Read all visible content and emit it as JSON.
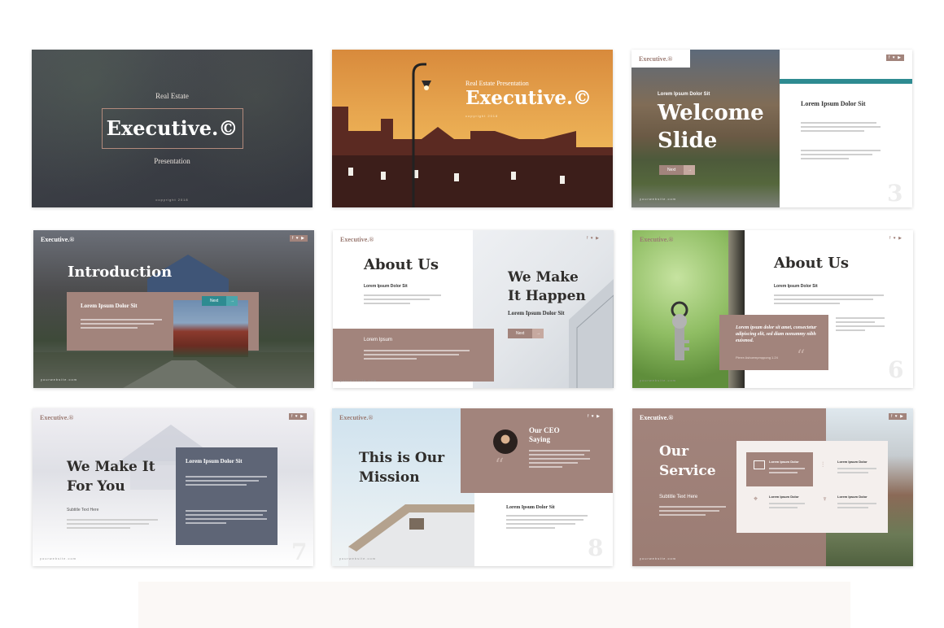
{
  "slides": [
    {
      "overline": "Real Estate",
      "title": "Executive.©",
      "subtitle": "Presentation",
      "footer": "copyright 2018"
    },
    {
      "overline": "Real Estate Presentation",
      "title": "Executive.©",
      "footer": "copyright 2018"
    },
    {
      "brand": "Executive.®",
      "social": "f ♥ ▶",
      "small_label": "Lorem Ipsum Dolor Sit",
      "title_line1": "Welcome",
      "title_line2": "Slide",
      "button": "Next",
      "panel_heading": "Lorem Ipsum Dolor Sit",
      "number": "3",
      "website": "yourwebsite.com"
    },
    {
      "brand": "Executive.®",
      "social": "f ♥ ▶",
      "title": "Introduction",
      "box_heading": "Lorem Ipsum Dolor Sit",
      "button": "Next",
      "website": "yourwebsite.com"
    },
    {
      "brand": "Executive.®",
      "social": "f ♥ ▶",
      "title": "About Us",
      "subheading": "Lorem Ipsum Dolor Sit",
      "box_heading": "Lorem Ipsum",
      "right_line1": "We Make",
      "right_line2": "It Happen",
      "right_sub": "Lorem Ipsum Dolor Sit",
      "button": "Next",
      "website": "yourwebsite.com"
    },
    {
      "brand": "Executive.®",
      "social": "f ♥ ▶",
      "title": "About Us",
      "subheading": "Lorem Ipsum Dolor Sit",
      "quote": "Lorem ipsum dolor sit amet, consectetur adipiscing elit, sed diam nonummy nibh euismod.",
      "quote_author": "Pierre Ashoempmppong 1.24",
      "number": "6",
      "website": "yourwebsite.com"
    },
    {
      "brand": "Executive.®",
      "social": "f ♥ ▶",
      "title_line1": "We Make It",
      "title_line2": "For You",
      "subtitle": "Subtitle Text Here",
      "box_heading": "Lorem Ipsum Dolor Sit",
      "number": "7",
      "website": "yourwebsite.com"
    },
    {
      "brand": "Executive.®",
      "social": "f ♥ ▶",
      "title_line1": "This is Our",
      "title_line2": "Mission",
      "ceo_line1": "Our CEO",
      "ceo_line2": "Saying",
      "bottom_heading": "Lorem Ipsum Dolor Sit",
      "number": "8",
      "website": "yourwebsite.com"
    },
    {
      "brand": "Executive.®",
      "social": "f ♥ ▶",
      "title_line1": "Our",
      "title_line2": "Service",
      "subtitle": "Subtitle Text Here",
      "service_heading": "Lorem Ipsum Dolor",
      "website": "yourwebsite.com"
    }
  ],
  "colors": {
    "accent": "#a2847c",
    "dark": "#2f2d2b",
    "slate": "#5e6576",
    "teal": "#2e8b91"
  }
}
